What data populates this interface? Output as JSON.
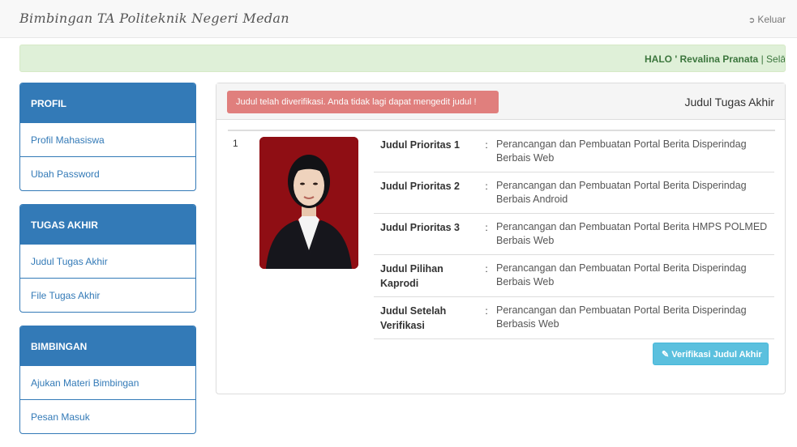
{
  "navbar": {
    "brand": "Bimbingan TA Politeknik Negeri Medan",
    "logout_label": "Keluar",
    "logout_icon": "sign-out-icon"
  },
  "greeting": {
    "prefix": "HALO ' Revalina Pranata",
    "suffix": " | Selā"
  },
  "sidebar": {
    "profil": {
      "heading": "PROFIL",
      "items": [
        {
          "label": "Profil Mahasiswa"
        },
        {
          "label": "Ubah Password"
        }
      ]
    },
    "tugas_akhir": {
      "heading": "TUGAS AKHIR",
      "items": [
        {
          "label": "Judul Tugas Akhir"
        },
        {
          "label": "File Tugas Akhir"
        }
      ]
    },
    "bimbingan": {
      "heading": "BIMBINGAN",
      "items": [
        {
          "label": "Ajukan Materi Bimbingan"
        },
        {
          "label": "Pesan Masuk"
        }
      ]
    }
  },
  "main": {
    "warning": "Judul telah diverifikasi. Anda tidak lagi dapat mengedit judul !",
    "title": "Judul Tugas Akhir",
    "row_number": "1",
    "colon": ":",
    "details": [
      {
        "label": "Judul Prioritas 1",
        "value": "Perancangan dan Pembuatan Portal Berita Disperindag Berbais Web"
      },
      {
        "label": "Judul Prioritas 2",
        "value": "Perancangan dan Pembuatan Portal Berita Disperindag Berbais Android"
      },
      {
        "label": "Judul Prioritas 3",
        "value": "Perancangan dan Pembuatan Portal Berita HMPS POLMED Berbais Web"
      },
      {
        "label": "Judul Pilihan Kaprodi",
        "value": "Perancangan dan Pembuatan Portal Berita Disperindag Berbais Web"
      },
      {
        "label": "Judul Setelah Verifikasi",
        "value": "Perancangan dan Pembuatan Portal Berita Disperindag Berbasis Web"
      }
    ],
    "verify_button": "Verifikasi Judul Akhir",
    "verify_icon": "edit-icon"
  },
  "colors": {
    "primary": "#337ab7",
    "success_bg": "#dff0d8",
    "danger": "#d9534f",
    "info": "#5bc0de"
  }
}
